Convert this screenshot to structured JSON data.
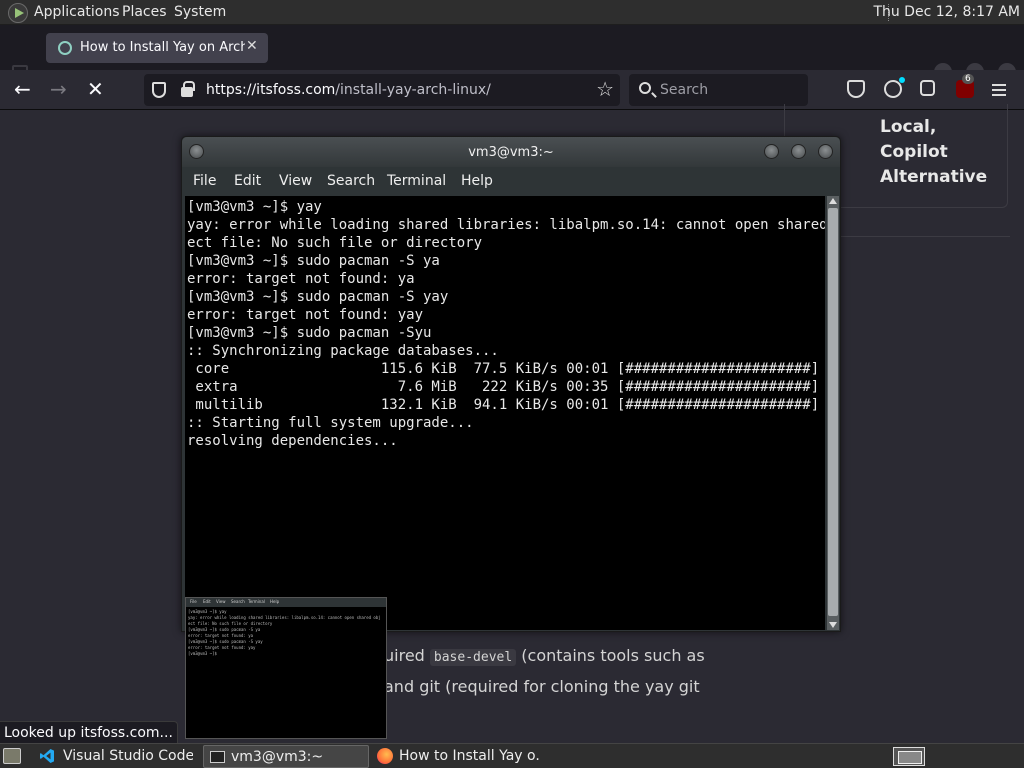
{
  "top_panel": {
    "menus": [
      "Applications",
      "Places",
      "System"
    ],
    "clock": "Thu Dec 12,  8:17 AM"
  },
  "browser": {
    "tab_title": "How to Install Yay on Arch L",
    "url_domain": "https://itsfoss.com",
    "url_path": "/install-yay-arch-linux/",
    "search_placeholder": "Search",
    "ublock_badge": "6"
  },
  "page": {
    "sidebar_text": "Local, Copilot Alternative",
    "article_line1_pre": "uired ",
    "article_line1_code": "base-devel",
    "article_line1_post": " (contains tools such as",
    "article_line2": "and git (required for cloning the yay git"
  },
  "status_tooltip": "Looked up itsfoss.com...",
  "terminal": {
    "title": "vm3@vm3:~",
    "menu": [
      "File",
      "Edit",
      "View",
      "Search",
      "Terminal",
      "Help"
    ],
    "lines": [
      "[vm3@vm3 ~]$ yay",
      "yay: error while loading shared libraries: libalpm.so.14: cannot open shared obj",
      "ect file: No such file or directory",
      "[vm3@vm3 ~]$ sudo pacman -S ya",
      "error: target not found: ya",
      "[vm3@vm3 ~]$ sudo pacman -S yay",
      "error: target not found: yay",
      "[vm3@vm3 ~]$ sudo pacman -Syu",
      ":: Synchronizing package databases...",
      " core                  115.6 KiB  77.5 KiB/s 00:01 [######################] 100%",
      " extra                   7.6 MiB   222 KiB/s 00:35 [######################] 100%",
      " multilib              132.1 KiB  94.1 KiB/s 00:01 [######################] 100%",
      ":: Starting full system upgrade...",
      "resolving dependencies..."
    ]
  },
  "thumbnail": {
    "menu": [
      "File",
      "Edit",
      "View",
      "Search",
      "Terminal",
      "Help"
    ],
    "lines": [
      "[vm3@vm3 ~]$ yay",
      "yay: error while loading shared libraries: libalpm.so.14: cannot open shared obj",
      "ect file: No such file or directory",
      "[vm3@vm3 ~]$ sudo pacman -S ya",
      "error: target not found: ya",
      "[vm3@vm3 ~]$ sudo pacman -S yay",
      "error: target not found: yay",
      "[vm3@vm3 ~]$ "
    ]
  },
  "taskbar": {
    "items": [
      "Visual Studio Code ...",
      "vm3@vm3:~",
      "How to Install Yay o..."
    ]
  },
  "colors": {
    "terminal_bg": "#000000",
    "vscode_blue": "#23a9f2"
  }
}
